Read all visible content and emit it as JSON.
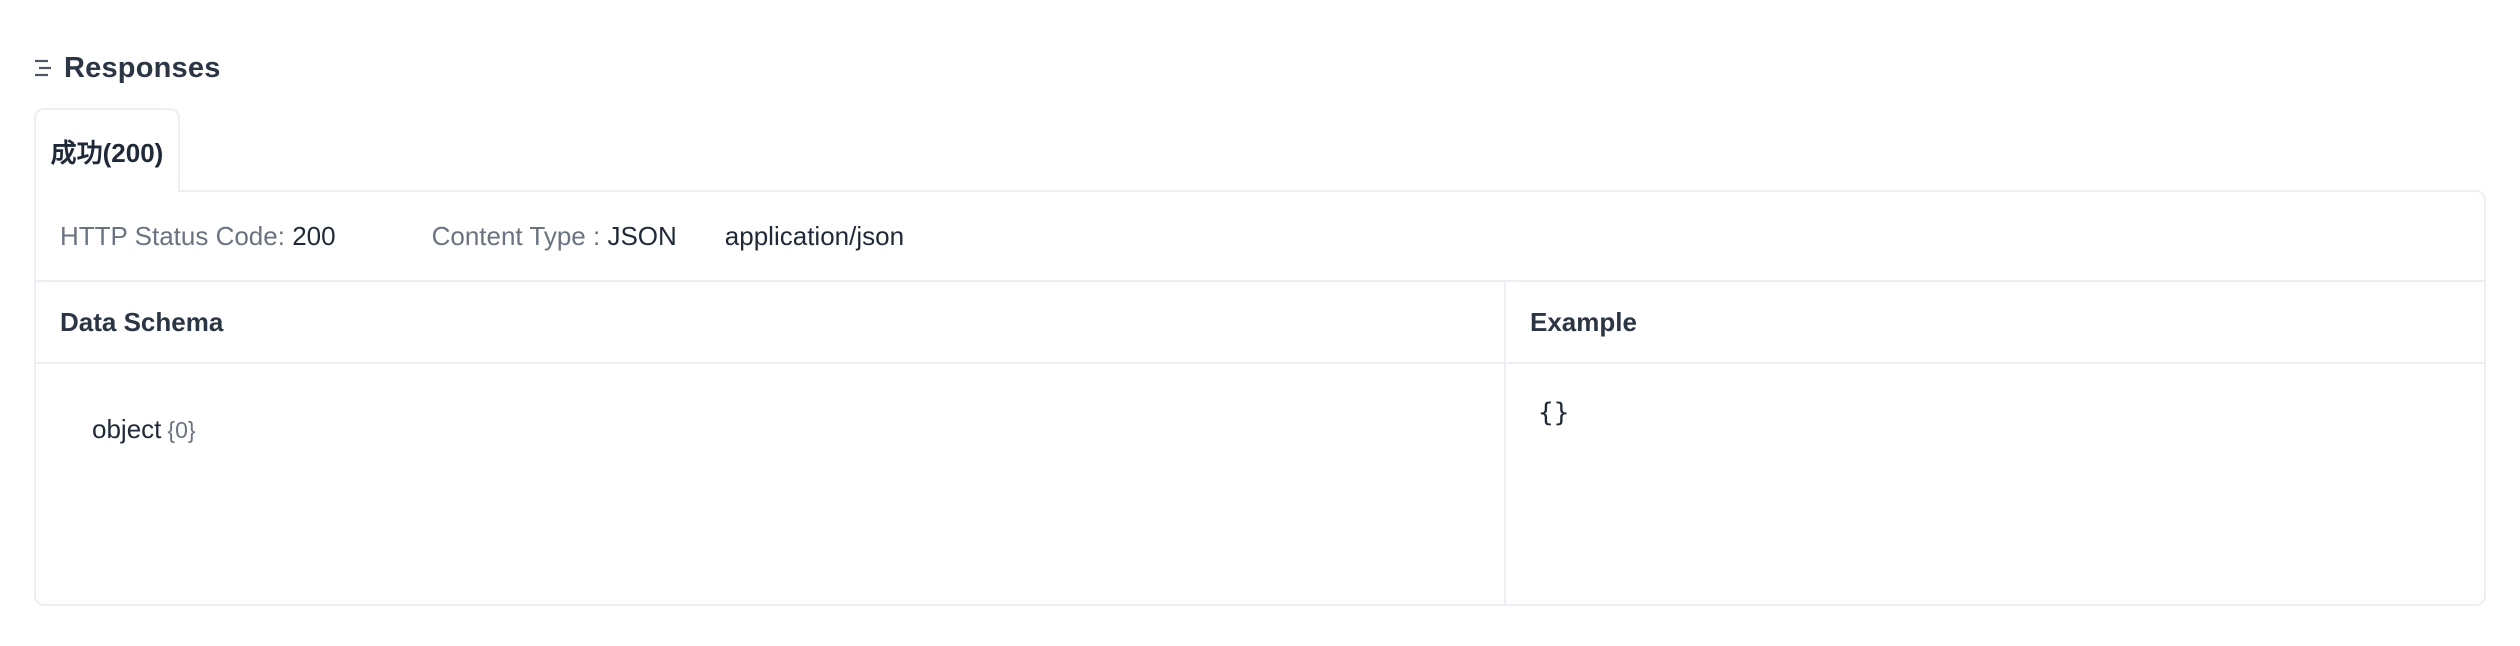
{
  "responses": {
    "title": "Responses",
    "icon": "list-icon"
  },
  "tabs": [
    {
      "label": "成功(200)",
      "active": true
    }
  ],
  "meta": {
    "status_label": "HTTP Status Code:",
    "status_value": "200",
    "content_type_label": "Content Type :",
    "content_type_value": "JSON",
    "mime_type": "application/json"
  },
  "schema": {
    "header": "Data Schema",
    "root_type": "object",
    "root_count": "{0}"
  },
  "example": {
    "header": "Example",
    "code": "{}"
  },
  "colors": {
    "border": "#eceff3",
    "text_primary": "#1f2937",
    "text_muted": "#6b7280"
  }
}
